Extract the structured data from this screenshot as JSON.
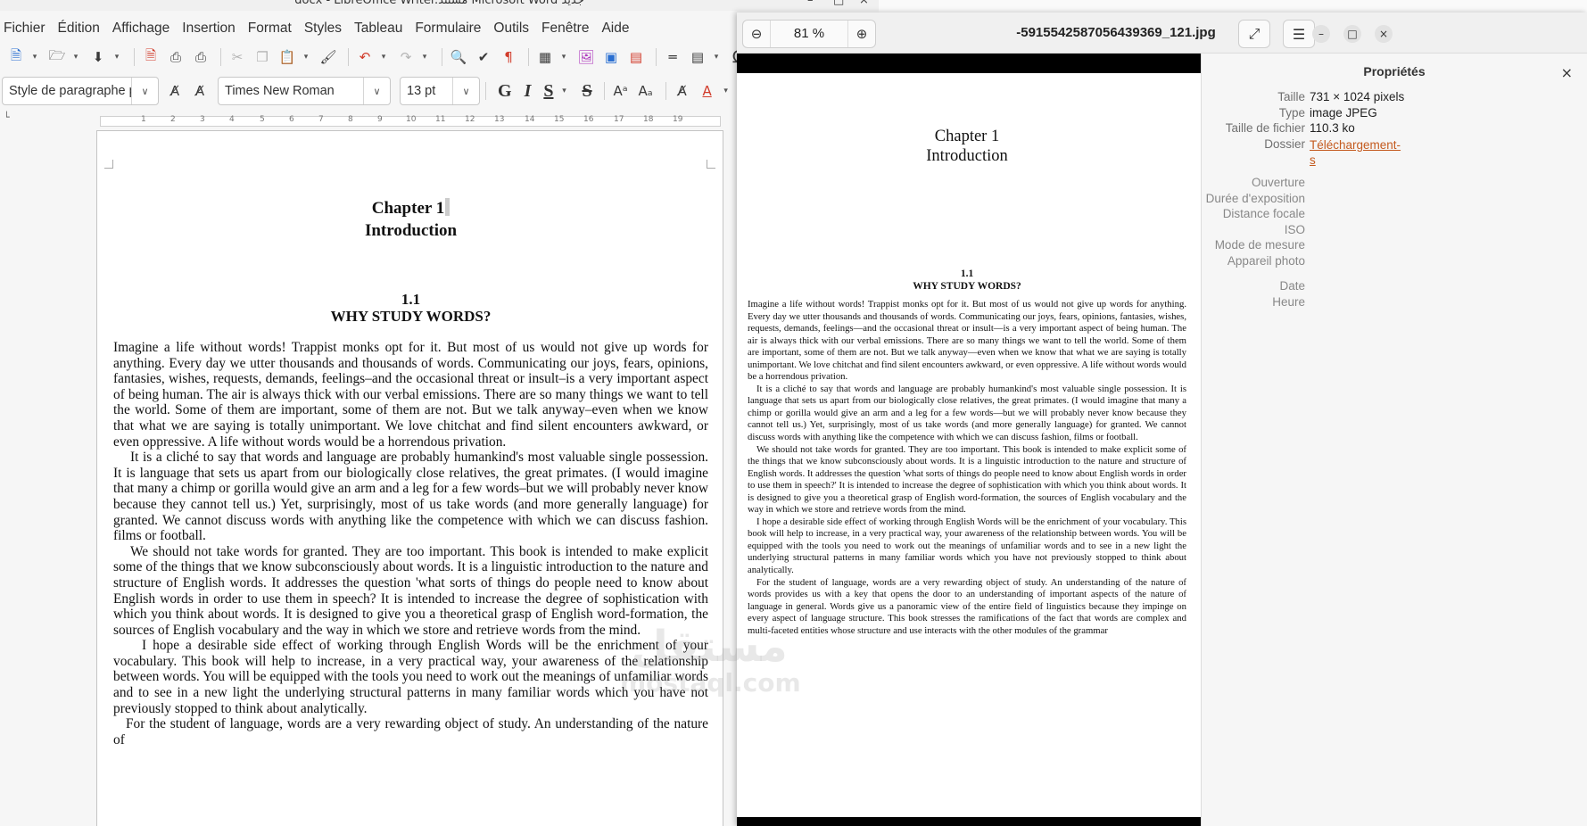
{
  "writer": {
    "window_title": "docx - LibreOffice Writer.مستند Microsoft Word جديد",
    "menu": [
      "Fichier",
      "Édition",
      "Affichage",
      "Insertion",
      "Format",
      "Styles",
      "Tableau",
      "Formulaire",
      "Outils",
      "Fenêtre",
      "Aide"
    ],
    "paragraph_style": "Style de paragraphe pa",
    "font_name": "Times New Roman",
    "font_size": "13 pt",
    "format_buttons": [
      "G",
      "I",
      "S",
      "S"
    ],
    "ruler_numbers": [
      "1",
      "2",
      "3",
      "4",
      "5",
      "6",
      "7",
      "8",
      "9",
      "10",
      "11",
      "12",
      "13",
      "14",
      "15",
      "16",
      "17",
      "18",
      "19"
    ],
    "document": {
      "chapter": "Chapter 1",
      "chapter_title": "Introduction",
      "section_number": "1.1",
      "section_title": "WHY STUDY WORDS?",
      "paragraphs": [
        "Imagine a life without words! Trappist monks opt for it. But most of us would not give up words for anything. Every day we utter thousands and thousands of words. Communicating our joys, fears, opinions, fantasies, wishes, requests, demands, feelings–and the occasional threat or insult–is a very important aspect of being human. The air is always thick with our verbal emissions. There are so many things we want to tell the world. Some of them are important, some of them are not. But we talk anyway–even when we know that what we are saying is totally unimportant. We love chitchat and find silent encounters awkward, or even oppressive. A life without words would be a horrendous privation.",
        "It is a cliché to say that words and language are probably humankind's most valuable single possession. It is language that sets us apart from our biologically close relatives, the great primates. (I would imagine that many a chimp or gorilla would give an arm and a leg for a few words–but we will probably never know because they cannot tell us.) Yet, surprisingly, most of us take words (and more generally language) for granted. We cannot discuss words with anything like the competence with which we can discuss fashion. films or football.",
        "We should not take words for granted. They are too important. This book is intended to make explicit some of the things that we know subconsciously about words. It is a linguistic introduction to the nature and structure of English words. It addresses the question 'what sorts of things do people need to know about English words in order to use them in speech? It is intended to increase the degree of sophistication with which you think about words. It is designed to give you a theoretical grasp of English word-formation, the sources of English vocabulary and the way in which we store and retrieve words from the mind.",
        "I hope a desirable side effect of working through English Words will be the enrichment of your vocabulary. This book will help to increase, in a very practical way, your awareness of the relationship between words. You will be equipped with the tools you need to work out the meanings of unfamiliar words and to see in a new light the underlying structural patterns in many familiar words which you have not previously stopped to think about analytically.",
        "For the student of language, words are a very rewarding object of study. An understanding of the nature of"
      ]
    }
  },
  "viewer": {
    "zoom": "81 %",
    "title": "-5915542587056439369_121.jpg",
    "image": {
      "chapter": "Chapter 1",
      "chapter_title": "Introduction",
      "section_number": "1.1",
      "section_title": "WHY STUDY WORDS?",
      "paragraphs": [
        "Imagine a life without words! Trappist monks opt for it. But most of us would not give up words for anything. Every day we utter thousands and thousands of words. Communicating our joys, fears, opinions, fantasies, wishes, requests, demands, feelings—and the occasional threat or insult—is a very important aspect of being human. The air is always thick with our verbal emissions. There are so many things we want to tell the world. Some of them are important, some of them are not. But we talk anyway—even when we know that what we are saying is totally unimportant. We love chitchat and find silent encounters awkward, or even oppressive. A life without words would be a horrendous privation.",
        "It is a cliché to say that words and language are probably humankind's most valuable single possession. It is language that sets us apart from our biologically close relatives, the great primates. (I would imagine that many a chimp or gorilla would give an arm and a leg for a few words—but we will probably never know because they cannot tell us.) Yet, surprisingly, most of us take words (and more generally language) for granted. We cannot discuss words with anything like the competence with which we can discuss fashion, films or football.",
        "We should not take words for granted. They are too important. This book is intended to make explicit some of the things that we know subconsciously about words. It is a linguistic introduction to the nature and structure of English words. It addresses the question 'what sorts of things do people need to know about English words in order to use them in speech?' It is intended to increase the degree of sophistication with which you think about words. It is designed to give you a theoretical grasp of English word-formation, the sources of English vocabulary and the way in which we store and retrieve words from the mind.",
        "I hope a desirable side effect of working through English Words will be the enrichment of your vocabulary. This book will help to increase, in a very practical way, your awareness of the relationship between words. You will be equipped with the tools you need to work out the meanings of unfamiliar words and to see in a new light the underlying structural patterns in many familiar words which you have not previously stopped to think about analytically.",
        "For the student of language, words are a very rewarding object of study. An understanding of the nature of words provides us with a key that opens the door to an understanding of important aspects of the nature of language in general. Words give us a panoramic view of the entire field of linguistics because they impinge on every aspect of language structure. This book stresses the ramifications of the fact that words are complex and multi-faceted entities whose structure and use interacts with the other modules of the grammar"
      ]
    },
    "properties": {
      "title": "Propriétés",
      "rows": [
        {
          "key": "Taille",
          "value": "731 × 1024 pixels"
        },
        {
          "key": "Type",
          "value": "image JPEG"
        },
        {
          "key": "Taille de fichier",
          "value": "110.3 ko"
        },
        {
          "key": "Dossier",
          "value": "Téléchargement-s"
        }
      ],
      "empty_rows": [
        "Ouverture",
        "Durée d'exposition",
        "Distance focale",
        "ISO",
        "Mode de mesure",
        "Appareil photo",
        "Date",
        "Heure"
      ]
    }
  },
  "watermark": {
    "line1": "مستقل",
    "line2": "mostaql.com"
  },
  "colors": {
    "link": "#c45a1e",
    "accent_blue": "#2a6fd1",
    "accent_red": "#d13b2a"
  }
}
